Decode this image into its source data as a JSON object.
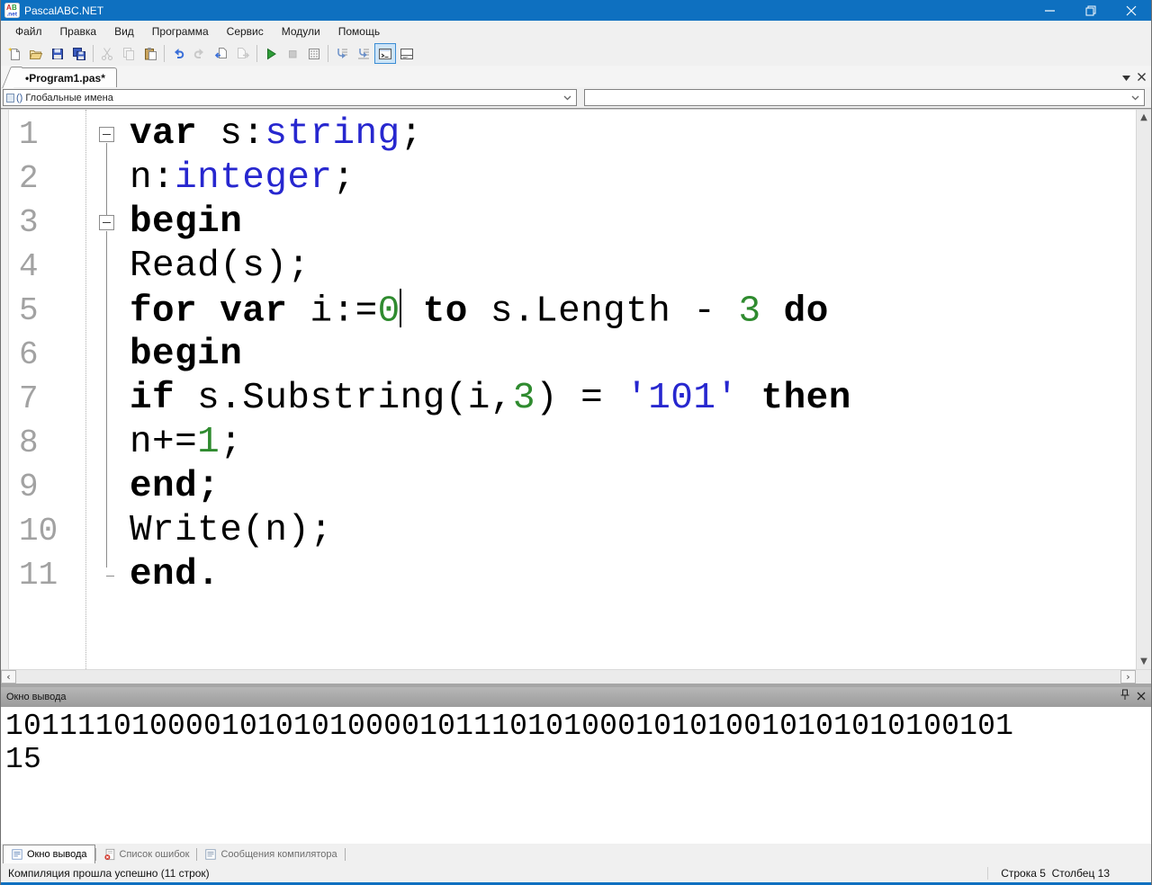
{
  "window": {
    "title": "PascalABC.NET"
  },
  "menu": {
    "items": [
      "Файл",
      "Правка",
      "Вид",
      "Программа",
      "Сервис",
      "Модули",
      "Помощь"
    ]
  },
  "toolbar": {
    "items": [
      {
        "icon": "new-file-icon"
      },
      {
        "icon": "open-file-icon"
      },
      {
        "icon": "save-icon"
      },
      {
        "icon": "save-all-icon"
      },
      {
        "sep": true
      },
      {
        "icon": "cut-icon",
        "disabled": true
      },
      {
        "icon": "copy-icon",
        "disabled": true
      },
      {
        "icon": "paste-icon"
      },
      {
        "sep": true
      },
      {
        "icon": "undo-icon"
      },
      {
        "icon": "redo-icon",
        "disabled": true
      },
      {
        "icon": "nav-back-icon"
      },
      {
        "icon": "nav-forward-icon",
        "disabled": true
      },
      {
        "sep": true
      },
      {
        "icon": "run-icon"
      },
      {
        "icon": "stop-icon",
        "disabled": true
      },
      {
        "icon": "debug-grid-icon"
      },
      {
        "sep": true
      },
      {
        "icon": "goto-def-icon"
      },
      {
        "icon": "goto-impl-icon"
      },
      {
        "icon": "console-toggle-icon",
        "active": true
      },
      {
        "icon": "layout-toggle-icon"
      }
    ]
  },
  "document_tab": {
    "label": "•Program1.pas*"
  },
  "navigation": {
    "scope_prefix": "()",
    "scope_value": "Глобальные имена",
    "member_value": ""
  },
  "editor": {
    "lines": [
      {
        "n": "1",
        "fold": "box-first",
        "code": [
          [
            "kw",
            "var"
          ],
          [
            "pl",
            " s:"
          ],
          [
            "ty",
            "string"
          ],
          [
            "pl",
            ";"
          ]
        ]
      },
      {
        "n": "2",
        "fold": "line",
        "code": [
          [
            "pl",
            "n:"
          ],
          [
            "ty",
            "integer"
          ],
          [
            "pl",
            ";"
          ]
        ]
      },
      {
        "n": "3",
        "fold": "box",
        "code": [
          [
            "kw",
            "begin"
          ]
        ]
      },
      {
        "n": "4",
        "fold": "line",
        "code": [
          [
            "pl",
            "Read(s);"
          ]
        ]
      },
      {
        "n": "5",
        "fold": "line",
        "code": [
          [
            "kw",
            "for"
          ],
          [
            "pl",
            " "
          ],
          [
            "kw",
            "var"
          ],
          [
            "pl",
            " i:="
          ],
          [
            "cnum",
            "0"
          ],
          [
            "caret",
            ""
          ],
          [
            "pl",
            " "
          ],
          [
            "kw",
            "to"
          ],
          [
            "pl",
            " s.Length - "
          ],
          [
            "cnum",
            "3"
          ],
          [
            "pl",
            " "
          ],
          [
            "kw",
            "do"
          ]
        ]
      },
      {
        "n": "6",
        "fold": "line",
        "code": [
          [
            "kw",
            "begin"
          ]
        ]
      },
      {
        "n": "7",
        "fold": "line",
        "code": [
          [
            "kw",
            "if"
          ],
          [
            "pl",
            " s.Substring(i,"
          ],
          [
            "cnum",
            "3"
          ],
          [
            "pl",
            ") = "
          ],
          [
            "str",
            "'101'"
          ],
          [
            "pl",
            " "
          ],
          [
            "kw",
            "then"
          ]
        ]
      },
      {
        "n": "8",
        "fold": "line",
        "code": [
          [
            "pl",
            "n+="
          ],
          [
            "cnum",
            "1"
          ],
          [
            "pl",
            ";"
          ]
        ]
      },
      {
        "n": "9",
        "fold": "line",
        "code": [
          [
            "kw",
            "end;"
          ]
        ]
      },
      {
        "n": "10",
        "fold": "line",
        "code": [
          [
            "pl",
            "Write(n);"
          ]
        ]
      },
      {
        "n": "11",
        "fold": "corner",
        "code": [
          [
            "kw",
            "end."
          ]
        ]
      }
    ]
  },
  "output_panel": {
    "title": "Окно вывода",
    "lines": [
      "10111101000010101010000101110101000101010010101010100101",
      "15"
    ]
  },
  "bottom_tabs": [
    {
      "label": "Окно вывода",
      "icon": "output-icon",
      "active": true
    },
    {
      "label": "Список ошибок",
      "icon": "error-list-icon",
      "active": false
    },
    {
      "label": "Сообщения компилятора",
      "icon": "compiler-messages-icon",
      "active": false
    }
  ],
  "status_bar": {
    "message": "Компиляция прошла успешно (11 строк)",
    "position": "Строка 5  Столбец 13"
  },
  "colors": {
    "accent": "#0e70c0",
    "keyword": "#000000",
    "type": "#2727cf",
    "number": "#2f8b2f",
    "string": "#2727cf",
    "line_number": "#a2a2a2",
    "run_green": "#2e9e38",
    "error_red": "#d23a2e"
  }
}
